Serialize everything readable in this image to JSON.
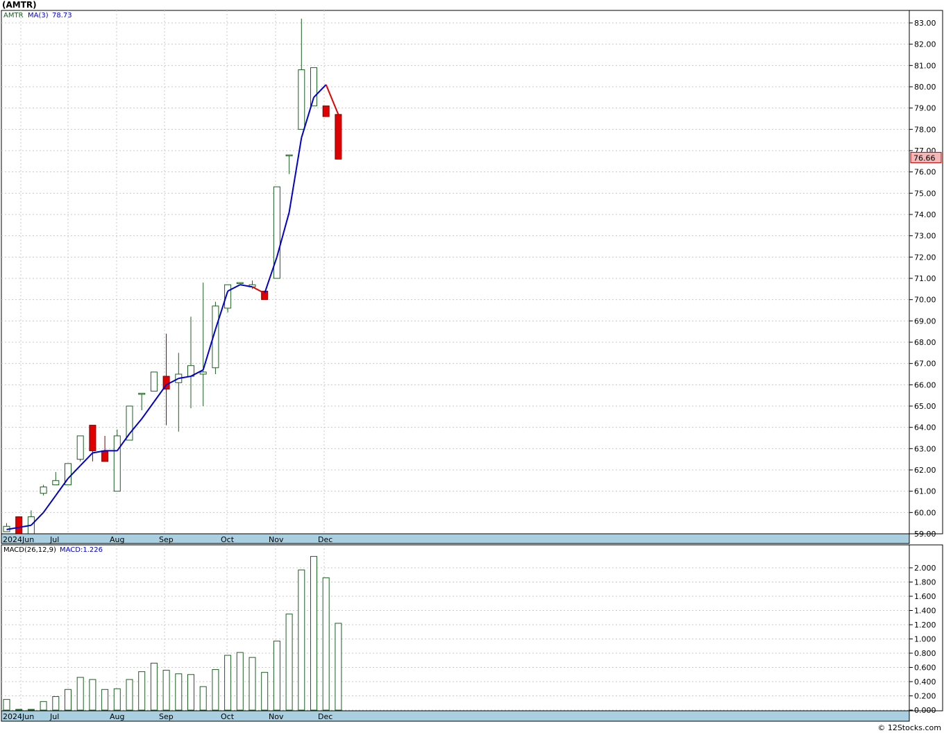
{
  "title": "(AMTR)",
  "watermark": "© 12Stocks.com",
  "colors": {
    "up": "#1b5e20",
    "down": "#e00000",
    "ma": "#0000cc",
    "ma_down": "#e00000",
    "grid": "#c8c8c8",
    "axisband": "#a9cfe0",
    "lastbox": "#f4b8b8"
  },
  "price_legend": {
    "symbol": "AMTR",
    "ma_label": "MA(3)",
    "ma_value": "78.73"
  },
  "macd_legend": {
    "label": "MACD(26,12,9)",
    "value_label": "MACD:1.226"
  },
  "last_price_label": "76.66",
  "month_labels": [
    "2024Jun",
    "Jul",
    "Aug",
    "Sep",
    "Oct",
    "Nov",
    "Dec"
  ],
  "chart_data": [
    {
      "type": "candlestick",
      "title": "",
      "ylim": [
        58.8,
        83.6
      ],
      "y_ticks": [
        "59.00",
        "60.00",
        "61.00",
        "62.00",
        "63.00",
        "64.00",
        "65.00",
        "66.00",
        "67.00",
        "68.00",
        "69.00",
        "70.00",
        "71.00",
        "72.00",
        "73.00",
        "74.00",
        "75.00",
        "76.00",
        "77.00",
        "78.00",
        "79.00",
        "80.00",
        "81.00",
        "82.00",
        "83.00"
      ],
      "grid": true,
      "candles": [
        {
          "o": 59.1,
          "h": 59.5,
          "l": 59.1,
          "c": 59.35
        },
        {
          "o": 59.8,
          "h": 59.8,
          "l": 58.8,
          "c": 58.8
        },
        {
          "o": 59.0,
          "h": 60.1,
          "l": 59.0,
          "c": 59.8
        },
        {
          "o": 60.9,
          "h": 61.3,
          "l": 60.8,
          "c": 61.2
        },
        {
          "o": 61.3,
          "h": 61.9,
          "l": 61.3,
          "c": 61.5
        },
        {
          "o": 61.3,
          "h": 62.3,
          "l": 61.3,
          "c": 62.3
        },
        {
          "o": 62.5,
          "h": 63.6,
          "l": 62.4,
          "c": 63.6
        },
        {
          "o": 64.1,
          "h": 64.1,
          "l": 62.4,
          "c": 62.9
        },
        {
          "o": 62.9,
          "h": 63.6,
          "l": 62.4,
          "c": 62.4
        },
        {
          "o": 61.0,
          "h": 63.9,
          "l": 61.0,
          "c": 63.6
        },
        {
          "o": 63.4,
          "h": 65.0,
          "l": 63.4,
          "c": 65.0
        },
        {
          "o": 65.6,
          "h": 65.6,
          "l": 64.8,
          "c": 65.6
        },
        {
          "o": 65.7,
          "h": 66.6,
          "l": 65.7,
          "c": 66.6
        },
        {
          "o": 66.4,
          "h": 68.4,
          "l": 64.1,
          "c": 65.8
        },
        {
          "o": 66.1,
          "h": 67.5,
          "l": 63.8,
          "c": 66.5
        },
        {
          "o": 66.4,
          "h": 69.2,
          "l": 64.9,
          "c": 66.9
        },
        {
          "o": 66.5,
          "h": 70.8,
          "l": 65.0,
          "c": 66.6
        },
        {
          "o": 66.8,
          "h": 69.9,
          "l": 66.5,
          "c": 69.7
        },
        {
          "o": 69.6,
          "h": 70.7,
          "l": 69.4,
          "c": 70.7
        },
        {
          "o": 70.8,
          "h": 70.8,
          "l": 70.8,
          "c": 70.8
        },
        {
          "o": 70.6,
          "h": 70.9,
          "l": 70.5,
          "c": 70.7
        },
        {
          "o": 70.4,
          "h": 70.4,
          "l": 70.0,
          "c": 70.0
        },
        {
          "o": 71.0,
          "h": 75.3,
          "l": 71.0,
          "c": 75.3
        },
        {
          "o": 76.8,
          "h": 76.8,
          "l": 75.9,
          "c": 76.8
        },
        {
          "o": 78.0,
          "h": 83.2,
          "l": 78.0,
          "c": 80.8
        },
        {
          "o": 79.1,
          "h": 80.9,
          "l": 79.1,
          "c": 80.9
        },
        {
          "o": 79.1,
          "h": 79.1,
          "l": 78.6,
          "c": 78.6
        },
        {
          "o": 78.7,
          "h": 78.7,
          "l": 76.6,
          "c": 76.6
        }
      ],
      "ma_series": {
        "name": "MA(3)",
        "values": [
          59.2,
          59.3,
          59.4,
          60.0,
          60.8,
          61.6,
          62.2,
          62.8,
          62.9,
          62.9,
          63.7,
          64.4,
          65.2,
          66.0,
          66.3,
          66.4,
          66.7,
          68.6,
          70.4,
          70.7,
          70.6,
          70.3,
          72.0,
          74.1,
          77.6,
          79.5,
          80.1,
          78.7
        ]
      }
    },
    {
      "type": "bar",
      "title": "",
      "ylim": [
        0,
        2.2
      ],
      "y_ticks": [
        "0.000",
        "0.200",
        "0.400",
        "0.600",
        "0.800",
        "1.000",
        "1.200",
        "1.400",
        "1.600",
        "1.800",
        "2.000"
      ],
      "grid": true,
      "values": [
        0.15,
        0.01,
        0.01,
        0.12,
        0.19,
        0.29,
        0.46,
        0.43,
        0.29,
        0.3,
        0.43,
        0.54,
        0.66,
        0.56,
        0.51,
        0.5,
        0.33,
        0.57,
        0.77,
        0.81,
        0.74,
        0.53,
        0.97,
        1.35,
        1.97,
        2.16,
        1.86,
        1.22
      ]
    }
  ]
}
